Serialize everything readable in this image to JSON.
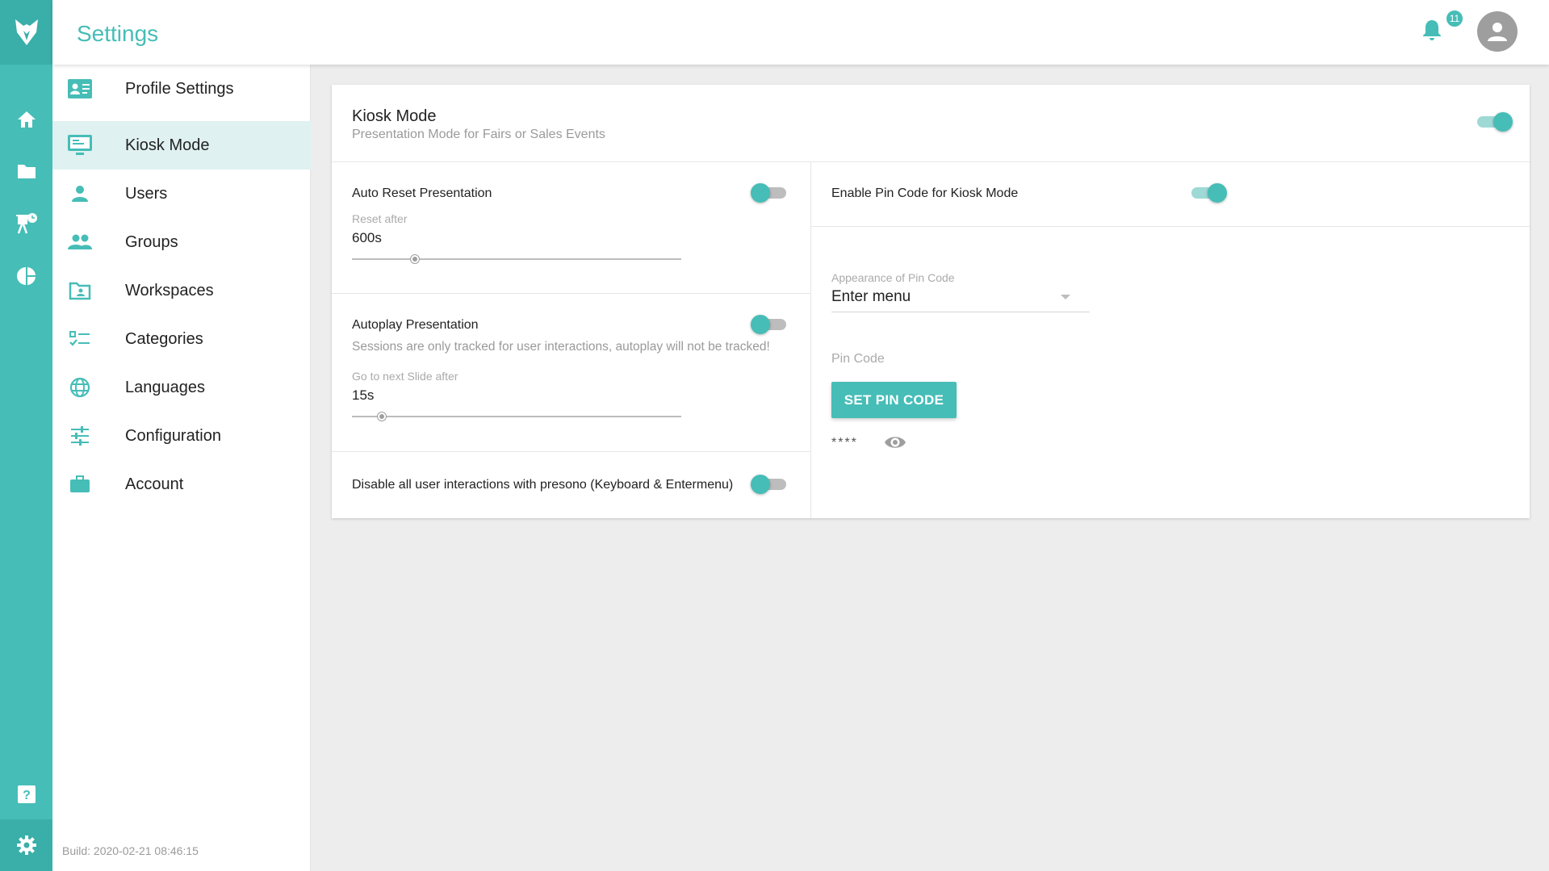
{
  "header": {
    "title": "Settings",
    "notification_count": "11"
  },
  "sidebar": {
    "items": [
      {
        "label": "Profile Settings",
        "icon": "profile-card-icon"
      },
      {
        "label": "Kiosk Mode",
        "icon": "monitor-icon",
        "active": true
      },
      {
        "label": "Users",
        "icon": "person-icon"
      },
      {
        "label": "Groups",
        "icon": "group-icon"
      },
      {
        "label": "Workspaces",
        "icon": "workspace-folder-icon"
      },
      {
        "label": "Categories",
        "icon": "checklist-icon"
      },
      {
        "label": "Languages",
        "icon": "globe-icon"
      },
      {
        "label": "Configuration",
        "icon": "tune-icon"
      },
      {
        "label": "Account",
        "icon": "briefcase-icon"
      }
    ],
    "build": "Build: 2020-02-21 08:46:15"
  },
  "rail": {
    "icons": [
      "home-icon",
      "folder-icon",
      "presentation-clock-icon",
      "pie-chart-icon",
      "help-icon",
      "gear-icon"
    ]
  },
  "kiosk": {
    "title": "Kiosk Mode",
    "subtitle": "Presentation Mode for Fairs or Sales Events",
    "enabled": true,
    "auto_reset": {
      "label": "Auto Reset Presentation",
      "enabled": false,
      "field_label": "Reset after",
      "value": "600s",
      "slider_fraction": 0.19
    },
    "autoplay": {
      "label": "Autoplay Presentation",
      "enabled": false,
      "note": "Sessions are only tracked for user interactions, autoplay will not be tracked!",
      "field_label": "Go to next Slide after",
      "value": "15s",
      "slider_fraction": 0.09
    },
    "disable_interactions": {
      "label": "Disable all user interactions with presono (Keyboard & Entermenu)",
      "enabled": false
    },
    "pin": {
      "label": "Enable Pin Code for Kiosk Mode",
      "enabled": true,
      "appearance_label": "Appearance of Pin Code",
      "appearance_value": "Enter menu",
      "pin_label": "Pin Code",
      "button_label": "SET PIN CODE",
      "masked": "****"
    }
  },
  "colors": {
    "accent": "#46bdb7",
    "accent_light": "#dff1f0"
  }
}
